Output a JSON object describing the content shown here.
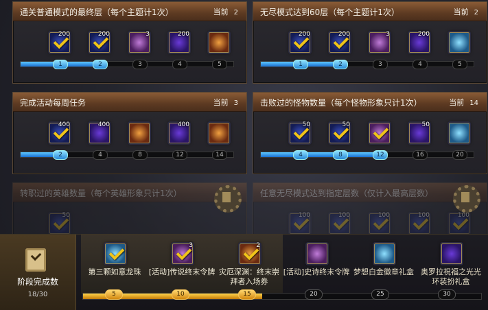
{
  "panels": [
    {
      "title": "通关普通模式的最终层（每个主题计1次）",
      "current_label": "当前",
      "current_value": "2",
      "rewards": [
        {
          "count": "200",
          "color": "navy",
          "done": true
        },
        {
          "count": "200",
          "color": "navy",
          "done": true
        },
        {
          "count": "3",
          "color": "pink",
          "done": false
        },
        {
          "count": "200",
          "color": "purple",
          "done": false
        },
        {
          "count": "",
          "color": "gold",
          "done": false
        }
      ],
      "nodes": [
        "1",
        "2",
        "3",
        "4",
        "5"
      ],
      "reached": 2
    },
    {
      "title": "无尽模式达到60层（每个主题计1次）",
      "current_label": "当前",
      "current_value": "2",
      "rewards": [
        {
          "count": "200",
          "color": "navy",
          "done": true
        },
        {
          "count": "200",
          "color": "navy",
          "done": true
        },
        {
          "count": "3",
          "color": "pink",
          "done": false
        },
        {
          "count": "200",
          "color": "purple",
          "done": false
        },
        {
          "count": "",
          "color": "teal",
          "done": false
        }
      ],
      "nodes": [
        "1",
        "2",
        "3",
        "4",
        "5"
      ],
      "reached": 2
    },
    {
      "title": "完成活动每周任务",
      "current_label": "当前",
      "current_value": "3",
      "rewards": [
        {
          "count": "400",
          "color": "navy",
          "done": true
        },
        {
          "count": "400",
          "color": "purple",
          "done": false
        },
        {
          "count": "",
          "color": "gold",
          "done": false
        },
        {
          "count": "400",
          "color": "purple",
          "done": false
        },
        {
          "count": "",
          "color": "gold",
          "done": false
        }
      ],
      "nodes": [
        "2",
        "4",
        "8",
        "12",
        "14"
      ],
      "reached": 1
    },
    {
      "title": "击败过的怪物数量（每个怪物形象只计1次）",
      "current_label": "当前",
      "current_value": "14",
      "rewards": [
        {
          "count": "50",
          "color": "navy",
          "done": true
        },
        {
          "count": "50",
          "color": "navy",
          "done": true
        },
        {
          "count": "",
          "color": "pink",
          "done": true
        },
        {
          "count": "50",
          "color": "purple",
          "done": false
        },
        {
          "count": "",
          "color": "teal",
          "done": false
        }
      ],
      "nodes": [
        "4",
        "8",
        "12",
        "16",
        "20"
      ],
      "reached": 3
    },
    {
      "title": "转职过的英雄数量（每个英雄形象只计1次）",
      "status": "完成",
      "rewards": [
        {
          "count": "50",
          "color": "navy",
          "done": true
        }
      ]
    },
    {
      "title": "任意无尽模式达到指定层数（仅计入最高层数）",
      "status": "完成",
      "rewards": [
        {
          "count": "100",
          "color": "navy",
          "done": true
        },
        {
          "count": "100",
          "color": "navy",
          "done": true
        },
        {
          "count": "100",
          "color": "navy",
          "done": true
        },
        {
          "count": "100",
          "color": "navy",
          "done": true
        },
        {
          "count": "100",
          "color": "navy",
          "done": true
        }
      ]
    }
  ],
  "stage": {
    "title": "阶段完成数",
    "progress": "18/30"
  },
  "stage_rewards": [
    {
      "label": "第三颗如意龙珠",
      "count": "",
      "color": "teal",
      "done": true,
      "node": "5"
    },
    {
      "label": "[活动]传说终末令牌",
      "count": "3",
      "color": "pink",
      "done": true,
      "node": "10"
    },
    {
      "label": "灾厄深渊：终末崇拜者入场券",
      "count": "2",
      "color": "gold",
      "done": true,
      "node": "15"
    },
    {
      "label": "[活动]史诗终末令牌",
      "count": "",
      "color": "pink",
      "done": false,
      "node": "20"
    },
    {
      "label": "梦想白金徽章礼盒",
      "count": "",
      "color": "teal",
      "done": false,
      "node": "25"
    },
    {
      "label": "奥罗拉祝福之光光环装扮礼盒",
      "count": "",
      "color": "purple",
      "done": false,
      "node": "30"
    }
  ],
  "stage_reached": 3
}
